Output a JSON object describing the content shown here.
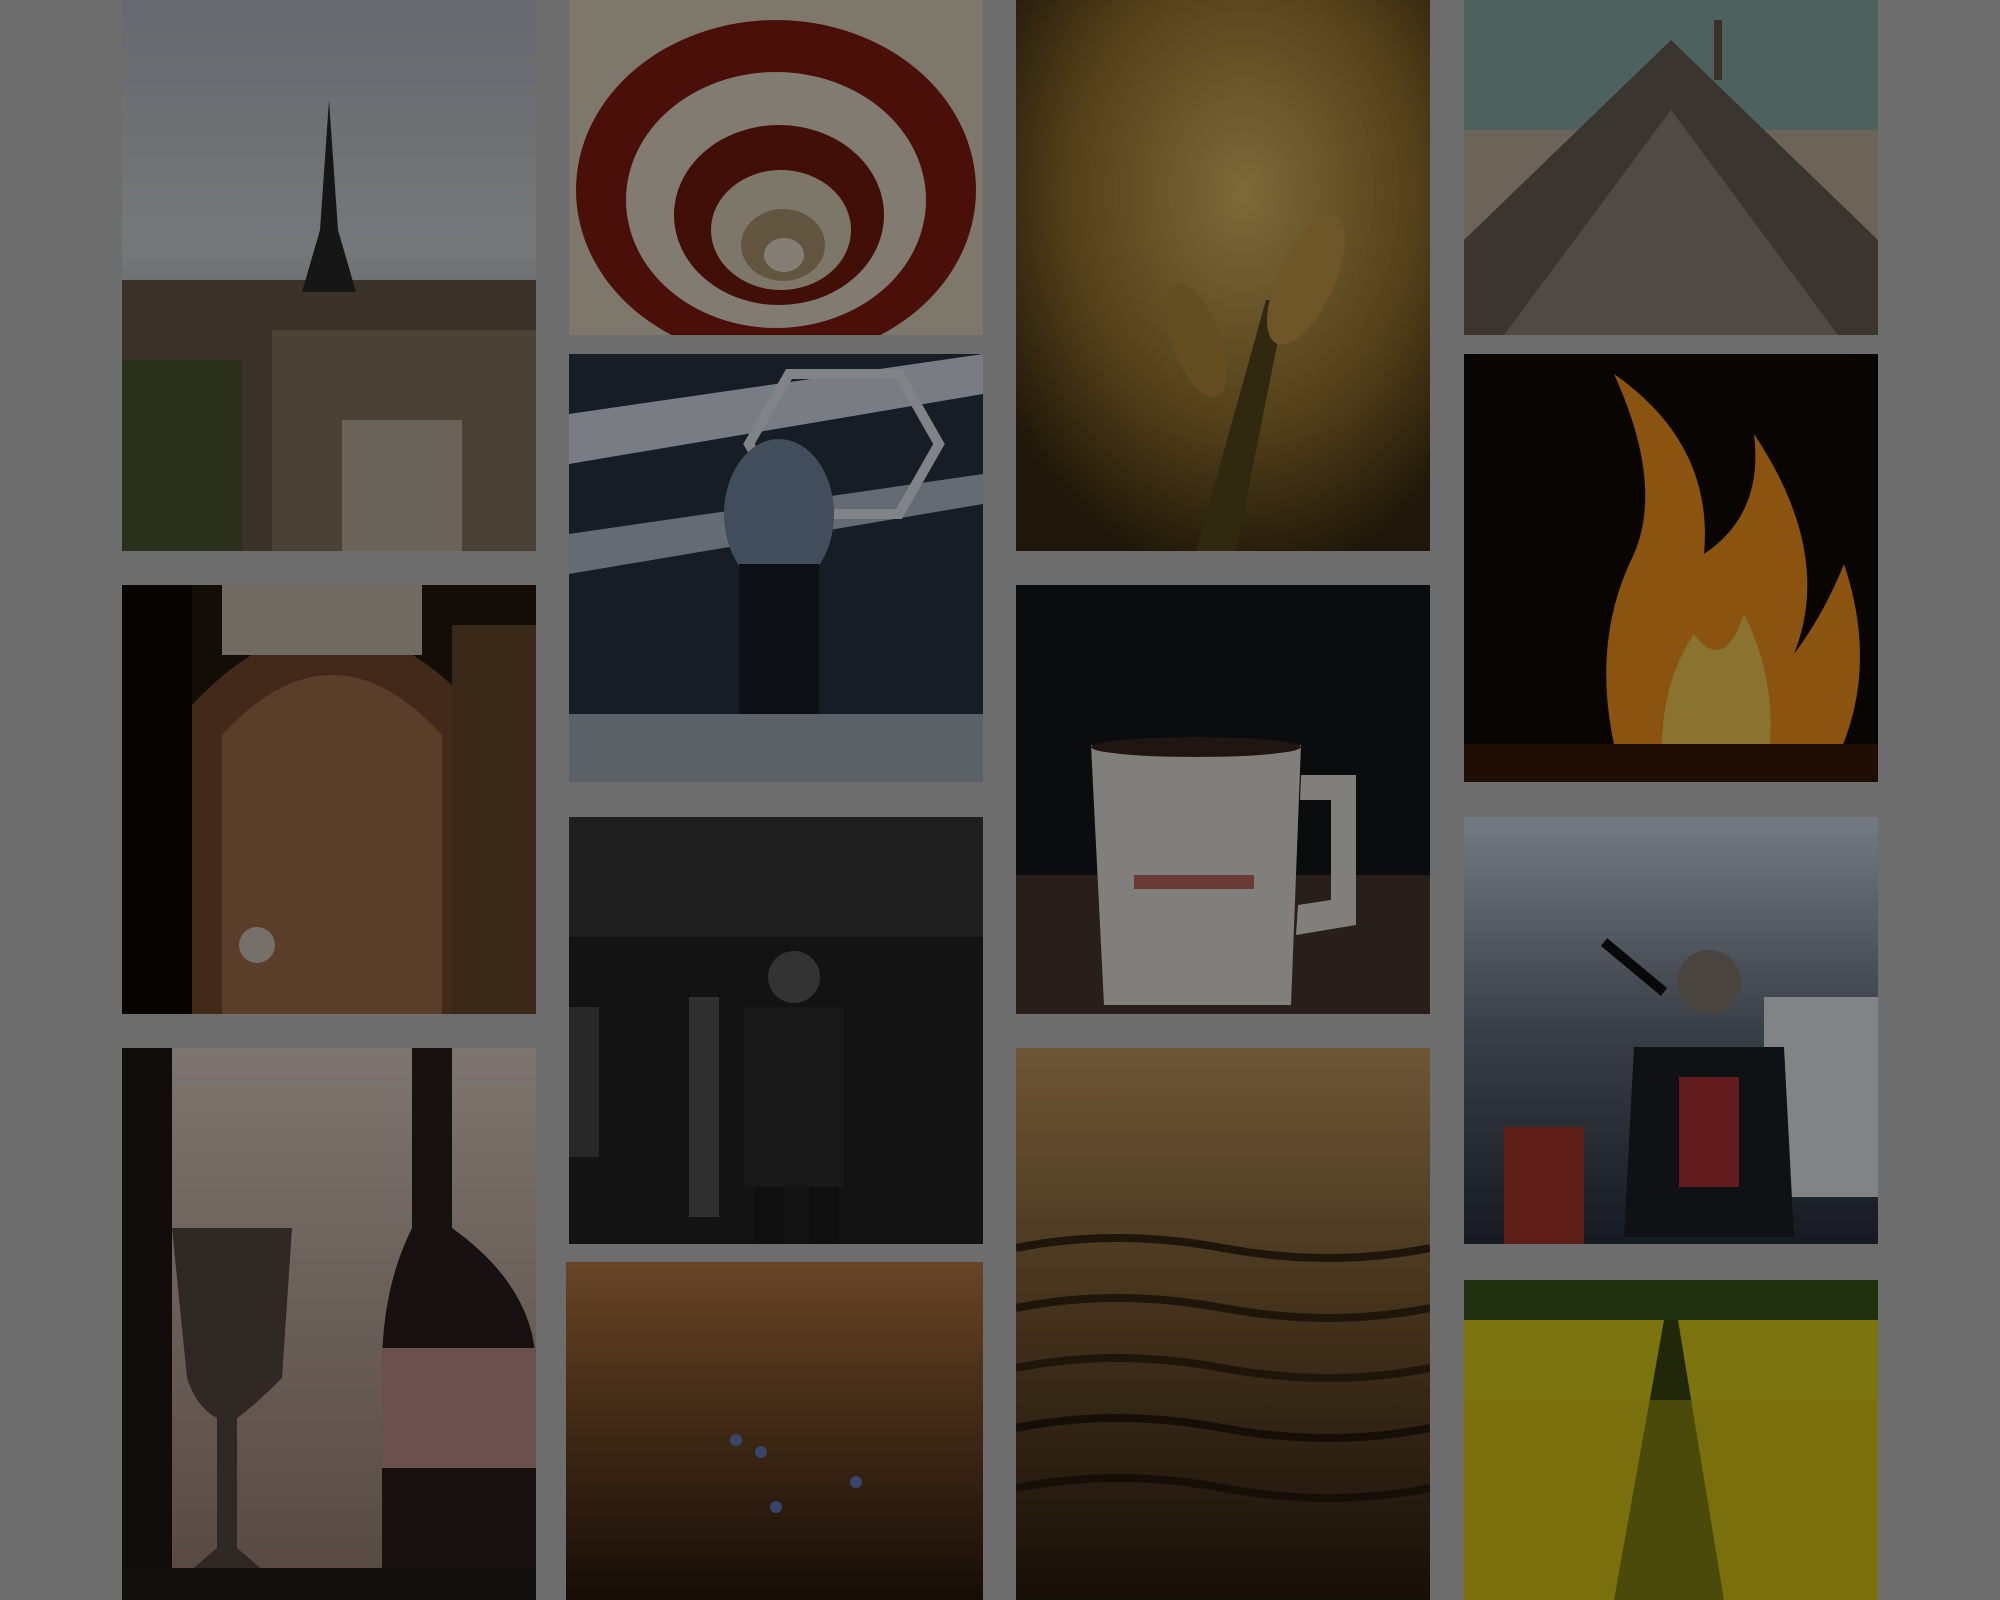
{
  "gallery": {
    "photos": [
      {
        "subject": "eiffel-tower-paris-skyline",
        "colors": {
          "sky": "#cfd5dc",
          "ground": "#5a4a3a"
        }
      },
      {
        "subject": "spiral-staircase",
        "colors": {
          "outer": "#e7dcc8",
          "inner": "#8a1d12"
        }
      },
      {
        "subject": "wheat-closeup",
        "colors": {
          "light": "#e0b85a",
          "dark": "#3a2c12"
        }
      },
      {
        "subject": "louvre-pyramid",
        "colors": {
          "sky": "#8fb4b0",
          "glass": "#7a6e63"
        }
      },
      {
        "subject": "concert-performer-stage",
        "colors": {
          "light": "#dfe8f2",
          "dark": "#1e2631"
        }
      },
      {
        "subject": "cathedral-interior",
        "colors": {
          "light": "#b07a52",
          "dark": "#1e140e"
        }
      },
      {
        "subject": "coffee-mug",
        "colors": {
          "mug": "#efeae4",
          "dark": "#151719"
        }
      },
      {
        "subject": "campfire",
        "colors": {
          "flame": "#ff9a1f",
          "dark": "#120a05"
        }
      },
      {
        "subject": "rapper-smoky-stage",
        "colors": {
          "light": "#5e5e5e",
          "dark": "#141414"
        }
      },
      {
        "subject": "singer-microphone",
        "colors": {
          "light": "#cfd8e6",
          "dark": "#1a1d24"
        }
      },
      {
        "subject": "wine-glass-and-bottle",
        "colors": {
          "light": "#e8d4c8",
          "dark": "#1a1414"
        }
      },
      {
        "subject": "wildflower-field-sunset",
        "colors": {
          "light": "#b2703a",
          "dark": "#2a1a0e"
        }
      },
      {
        "subject": "sand-ripples-sunset",
        "colors": {
          "light": "#caa063",
          "dark": "#2a1d10"
        }
      },
      {
        "subject": "yellow-rapeseed-field",
        "colors": {
          "light": "#f0e21d",
          "dark": "#3d4a12"
        }
      }
    ],
    "overlay_color": "#000000"
  }
}
